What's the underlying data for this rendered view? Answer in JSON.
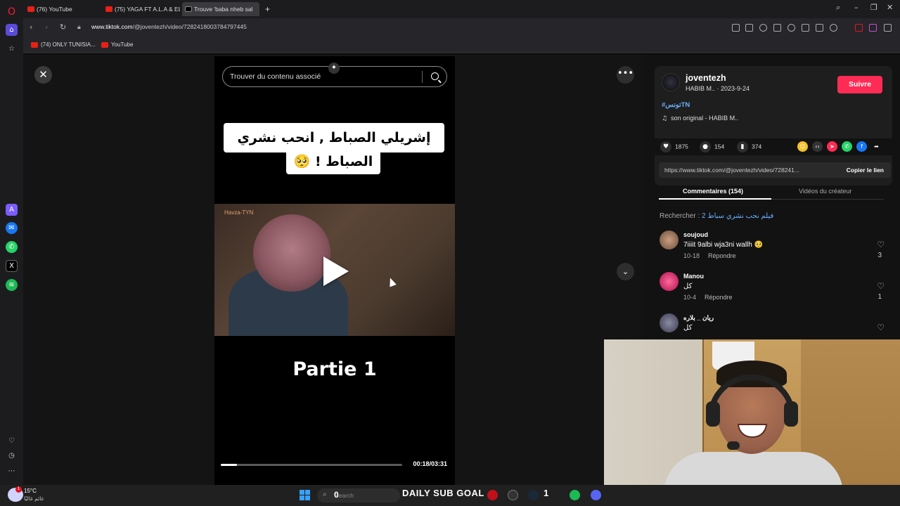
{
  "browser": {
    "tabs": [
      {
        "label": "(76) YouTube"
      },
      {
        "label": "(75) YAGA FT A.L.A & EL C"
      },
      {
        "label": "Trouve 'baba nheb sal"
      }
    ],
    "new_tab_symbol": "+",
    "url_domain": "www.tiktok.com",
    "url_path": "/@joventezh/video/7282418003784797445",
    "bookmarks": [
      {
        "label": "(74) ONLY TUNISIA..."
      },
      {
        "label": "YouTube"
      }
    ]
  },
  "video": {
    "search_placeholder": "Trouver du contenu associé",
    "caption_line1": "إشريلي الصباط , انحب نشري",
    "caption_line2": "الصباط ! 🥺",
    "watermark": "Havza-TYN",
    "overlay_text": "Partie 1",
    "time": "00:18/03:31",
    "progress_fraction": 0.09
  },
  "author": {
    "username": "joventezh",
    "subline": "HABIB M.. · 2023-9-24",
    "follow_label": "Suivre",
    "hashtag": "#تونسTN",
    "music": "son original - HABIB M..",
    "likes": "1875",
    "comments": "154",
    "saves": "374",
    "link": "https://www.tiktok.com/@joventezh/video/728241...",
    "copy_label": "Copier le lien"
  },
  "tabs": {
    "comments_label": "Commentaires (154)",
    "creator_label": "Vidéos du créateur"
  },
  "search_suggestion": {
    "prefix": "Rechercher : ",
    "query": "فيلم نحب نشري سباط 2"
  },
  "comments": [
    {
      "user": "soujoud",
      "text": "7iiiit 9albi wja3ni wallh 🥺",
      "date": "10-18",
      "reply": "Répondre",
      "likes": "3"
    },
    {
      "user": "Manou",
      "text": "كل",
      "date": "10-4",
      "reply": "Répondre",
      "likes": "1"
    },
    {
      "user": "ريان _ بلاره",
      "text": "كل",
      "date": "",
      "reply": "",
      "likes": ""
    }
  ],
  "taskbar": {
    "temperature": "15°C",
    "weather_desc": "غائم غالبًا",
    "weather_badge": "1",
    "search_placeholder": "Search",
    "search_number": "0",
    "sub_goal": "DAILY SUB GOAL",
    "counter": "1"
  },
  "colors": {
    "accent": "#fe2c55",
    "link": "#6ab0ff"
  }
}
